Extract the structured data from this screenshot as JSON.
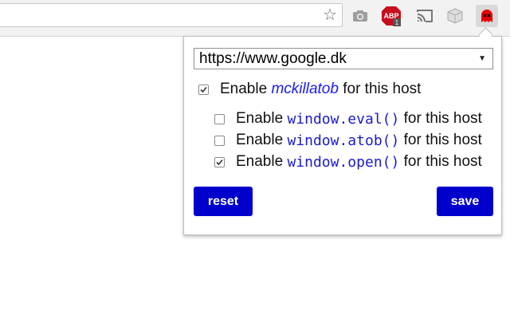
{
  "browser": {
    "omnibox": {
      "value": ""
    },
    "extensions": [
      {
        "name": "camera-icon"
      },
      {
        "name": "adblock-plus-icon",
        "label": "ABP",
        "badge": "1"
      },
      {
        "name": "cast-icon"
      },
      {
        "name": "cube-icon"
      },
      {
        "name": "mckillatob-icon"
      }
    ]
  },
  "popup": {
    "host_selected": "https://www.google.dk",
    "enable_prefix": "Enable",
    "enable_suffix": "for this host",
    "main_option": {
      "name": "mckillatob",
      "checked": true
    },
    "options": [
      {
        "code": "window.eval()",
        "checked": false
      },
      {
        "code": "window.atob()",
        "checked": false
      },
      {
        "code": "window.open()",
        "checked": true
      }
    ],
    "reset_label": "reset",
    "save_label": "save"
  },
  "colors": {
    "accent": "#0000cc",
    "link_blue": "#1a1aff",
    "ghost_red": "#e60000"
  }
}
